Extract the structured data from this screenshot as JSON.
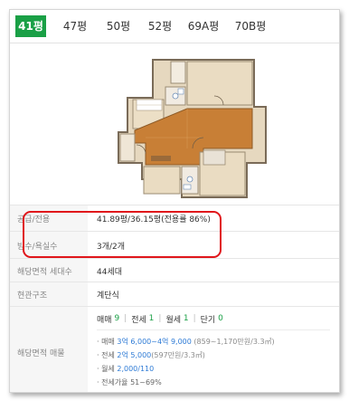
{
  "tabs": [
    "41평",
    "47평",
    "50평",
    "52평",
    "69A평",
    "70B평"
  ],
  "details": {
    "supply_label": "공급/전용",
    "supply_value": "41.89평/36.15평(전용률 86%)",
    "rooms_label": "방수/욕실수",
    "rooms_value": "3개/2개",
    "households_label": "해당면적 세대수",
    "households_value": "44세대",
    "structure_label": "현관구조",
    "structure_value": "계단식",
    "listings_label": "해당면적 매물"
  },
  "listing_counts": {
    "sale_label": "매매",
    "sale_count": "9",
    "jeonse_label": "전세",
    "jeonse_count": "1",
    "monthly_label": "월세",
    "monthly_count": "1",
    "short_label": "단기",
    "short_count": "0"
  },
  "price_lines": {
    "sale_prefix": "· 매매 ",
    "sale_price": "3억 6,000~4억 9,000",
    "sale_unit": " (859~1,170만원/3.3㎡)",
    "jeonse_prefix": "· 전세 ",
    "jeonse_price": "2억 5,000",
    "jeonse_unit": "(597만원/3.3㎡)",
    "monthly_prefix": "· 월세 ",
    "monthly_price": "2,000/110",
    "ratio": "· 전세가율 51~69%"
  },
  "colors": {
    "accent": "#1aa046",
    "highlight": "#e0161b",
    "link": "#2e7bd6"
  }
}
